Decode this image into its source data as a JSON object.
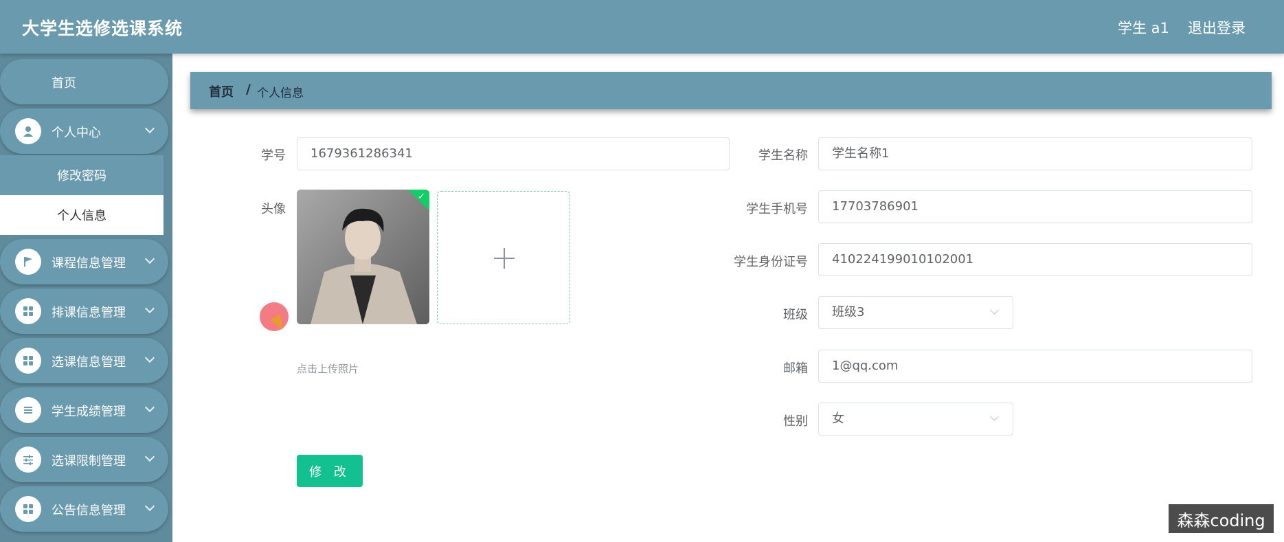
{
  "header": {
    "app_title": "大学生选修选课系统",
    "user": "学生 a1",
    "logout": "退出登录"
  },
  "sidebar": {
    "home": "首页",
    "items": [
      {
        "label": "个人中心",
        "icon": "user-icon"
      },
      {
        "label": "课程信息管理",
        "icon": "flag-icon"
      },
      {
        "label": "排课信息管理",
        "icon": "grid-icon"
      },
      {
        "label": "选课信息管理",
        "icon": "grid-icon"
      },
      {
        "label": "学生成绩管理",
        "icon": "list-icon"
      },
      {
        "label": "选课限制管理",
        "icon": "sliders-icon"
      },
      {
        "label": "公告信息管理",
        "icon": "grid-icon"
      }
    ],
    "submenu": {
      "change_password": "修改密码",
      "personal_info": "个人信息"
    }
  },
  "breadcrumb": {
    "home": "首页",
    "separator": "/",
    "current": "个人信息"
  },
  "form": {
    "student_no": {
      "label": "学号",
      "value": "1679361286341"
    },
    "avatar": {
      "label": "头像",
      "hint": "点击上传照片"
    },
    "student_name": {
      "label": "学生名称",
      "value": "学生名称1"
    },
    "phone": {
      "label": "学生手机号",
      "value": "17703786901"
    },
    "id_card": {
      "label": "学生身份证号",
      "value": "410224199010102001"
    },
    "class": {
      "label": "班级",
      "value": "班级3"
    },
    "email": {
      "label": "邮箱",
      "value": "1@qq.com"
    },
    "gender": {
      "label": "性别",
      "value": "女"
    },
    "submit": "修 改"
  },
  "watermark": "森森coding",
  "colors": {
    "primary": "#6a9aae",
    "sidebar": "#5f8b9c",
    "button": "#13c08f",
    "success": "#13ce66"
  }
}
